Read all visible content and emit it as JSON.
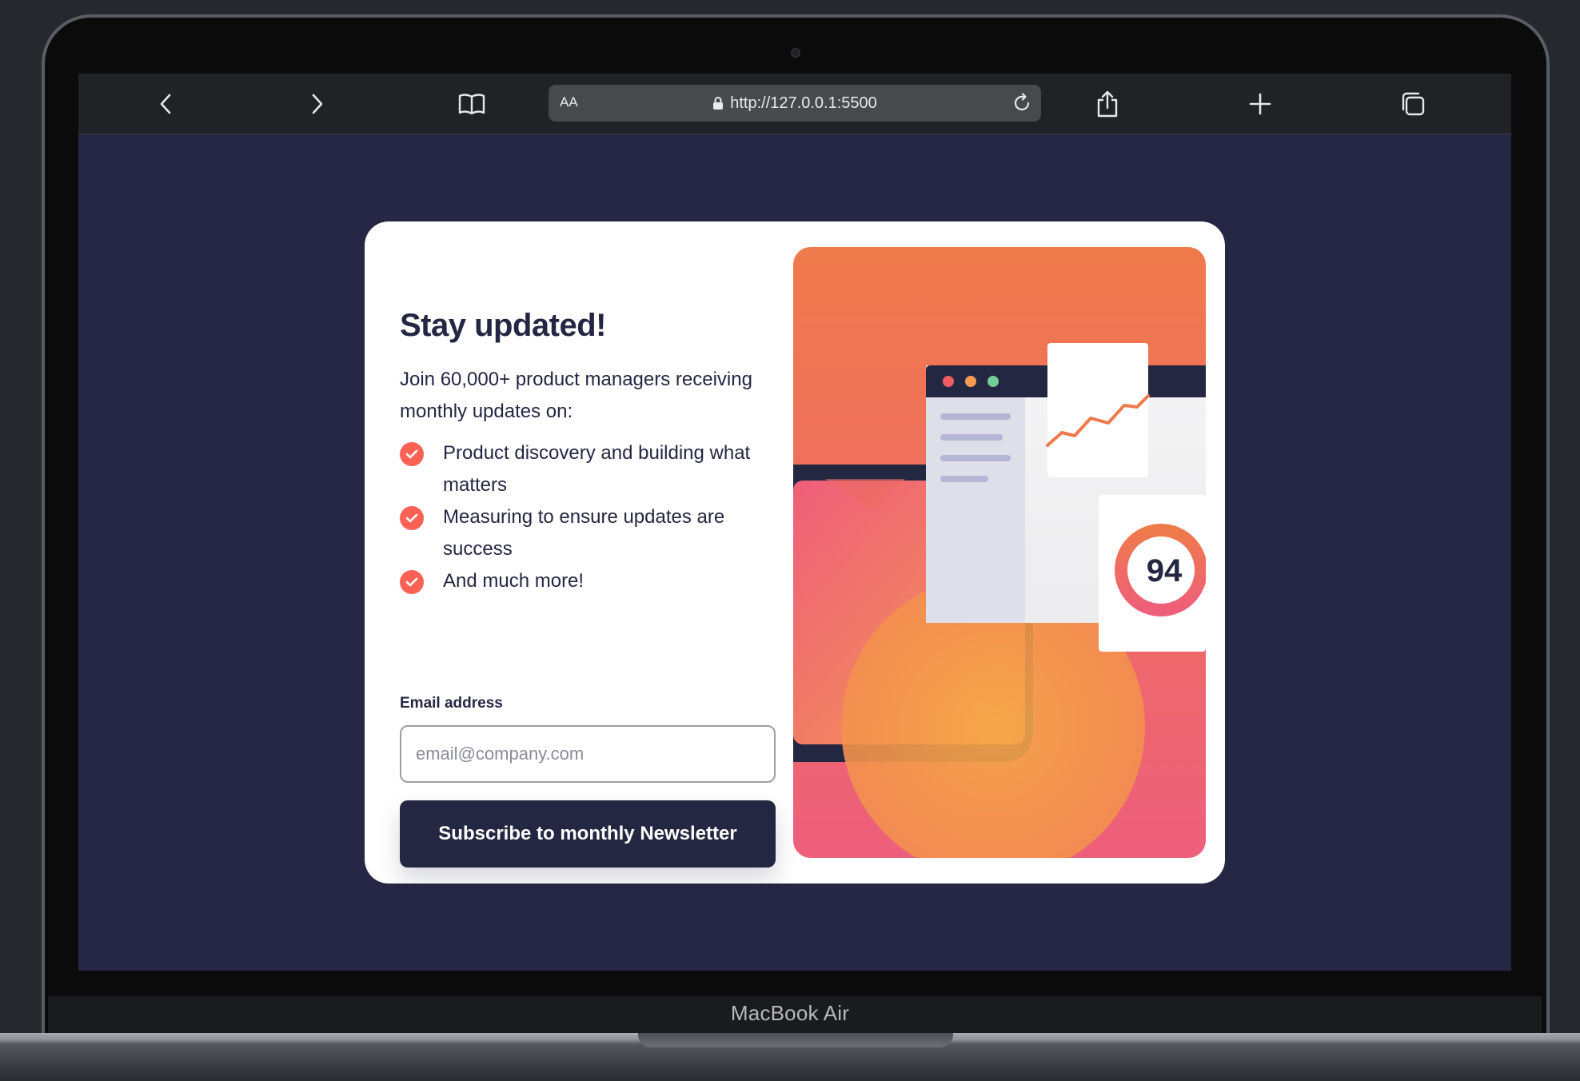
{
  "device": {
    "brand": "MacBook Air"
  },
  "browser": {
    "text_size_label": "AA",
    "url": "http://127.0.0.1:5500",
    "icons": [
      "back-icon",
      "forward-icon",
      "bookmarks-icon",
      "lock-icon",
      "reload-icon",
      "share-icon",
      "new-tab-icon",
      "tabs-icon"
    ]
  },
  "newsletter": {
    "title": "Stay updated!",
    "intro": "Join 60,000+ product managers receiving monthly updates on:",
    "features": [
      "Product discovery and building what matters",
      "Measuring to ensure updates are success",
      "And much more!"
    ],
    "email_label": "Email address",
    "email_placeholder": "email@company.com",
    "email_value": "",
    "subscribe_label": "Subscribe to monthly Newsletter"
  },
  "illustration": {
    "score": "94"
  },
  "colors": {
    "page_background": "#252744",
    "card_background": "#ffffff",
    "text_dark": "#242742",
    "accent_tomato": "#ff6155",
    "gradient_top": "#ff6a3a",
    "gradient_bottom": "#ff527b"
  }
}
